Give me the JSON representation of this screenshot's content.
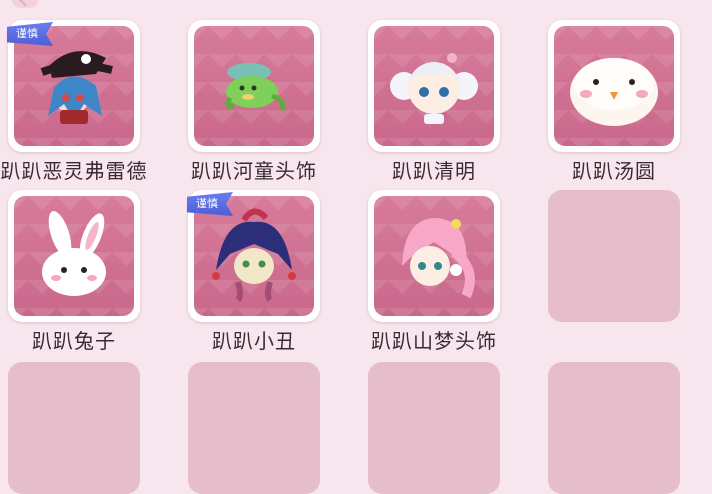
{
  "items": [
    {
      "name": "趴趴恶灵弗雷德",
      "badge": "谨慎",
      "icon": "pirate-ghost-hat-icon"
    },
    {
      "name": "趴趴河童头饰",
      "icon": "kappa-headwear-icon"
    },
    {
      "name": "趴趴清明",
      "icon": "white-haired-girl-icon"
    },
    {
      "name": "趴趴汤圆",
      "icon": "white-dumpling-icon"
    },
    {
      "name": "趴趴兔子",
      "icon": "white-rabbit-icon"
    },
    {
      "name": "趴趴小丑",
      "badge": "谨慎",
      "icon": "jester-icon"
    },
    {
      "name": "趴趴山梦头饰",
      "icon": "pink-haired-girl-icon"
    }
  ],
  "colors": {
    "accent": "#c9688b",
    "background": "#f8e6ee",
    "badge": "#5a6ce3"
  }
}
